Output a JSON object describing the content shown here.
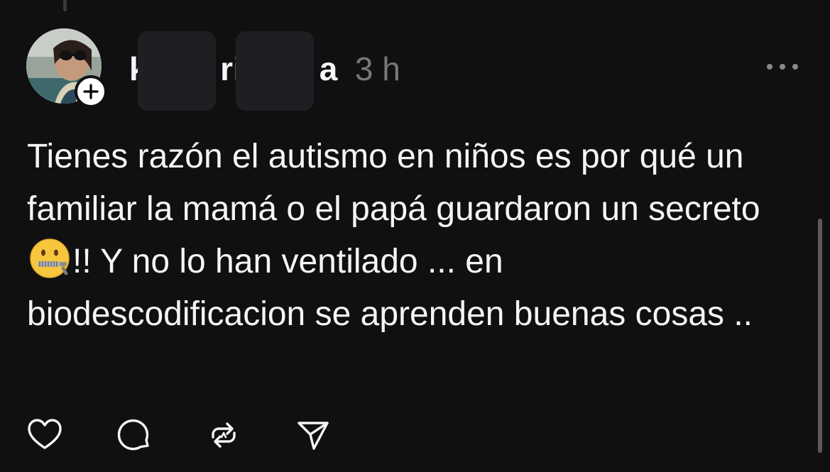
{
  "post": {
    "username_visible": "k ri a",
    "username_parts": [
      "k",
      "ri",
      "a"
    ],
    "timestamp": "3 h",
    "text_before_emoji": "Tienes razón el autismo en niños es por qué un familiar la mamá o el papá guardaron un secreto ",
    "emoji": "zipper-mouth-face",
    "text_after_emoji": "!! Y no lo han ventilado ... en biodescodificacion se aprenden buenas cosas .."
  },
  "icons": {
    "follow": "plus-icon",
    "more": "more-options-icon",
    "like": "heart-icon",
    "reply": "comment-icon",
    "repost": "repost-icon",
    "share": "send-icon"
  },
  "colors": {
    "background": "#101010",
    "text": "#f3f5f7",
    "muted": "#777777"
  }
}
